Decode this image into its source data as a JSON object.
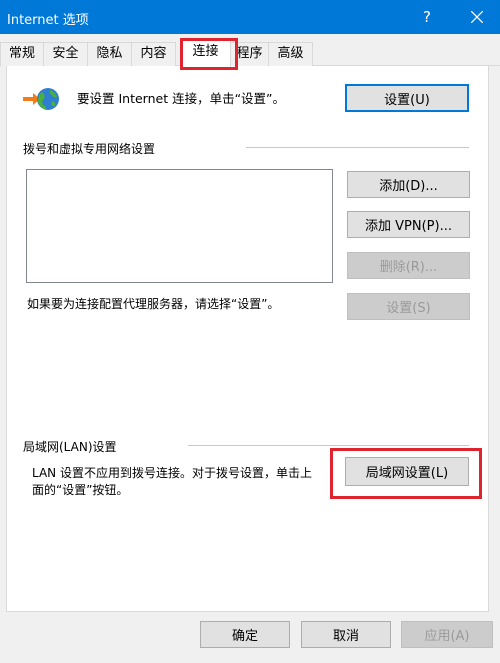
{
  "window": {
    "title": "Internet 选项",
    "help_label": "?"
  },
  "tabs": [
    {
      "label": "常规"
    },
    {
      "label": "安全"
    },
    {
      "label": "隐私"
    },
    {
      "label": "内容"
    },
    {
      "label": "连接",
      "active": true
    },
    {
      "label": "程序"
    },
    {
      "label": "高级"
    }
  ],
  "setup": {
    "text": "要设置 Internet 连接，单击“设置”。",
    "button": "设置(U)"
  },
  "dialup": {
    "heading": "拨号和虚拟专用网络设置",
    "add_button": "添加(D)...",
    "add_vpn_button": "添加 VPN(P)...",
    "delete_button": "删除(R)...",
    "proxy_text": "如果要为连接配置代理服务器，请选择“设置”。",
    "settings_button": "设置(S)"
  },
  "lan": {
    "heading": "局域网(LAN)设置",
    "text_line1": "LAN 设置不应用到拨号连接。对于拨号设置，单击上",
    "text_line2": "面的“设置”按钮。",
    "button": "局域网设置(L)"
  },
  "footer": {
    "ok": "确定",
    "cancel": "取消",
    "apply": "应用(A)"
  },
  "colors": {
    "titlebar": "#0078d7",
    "highlight": "#e0242f"
  }
}
